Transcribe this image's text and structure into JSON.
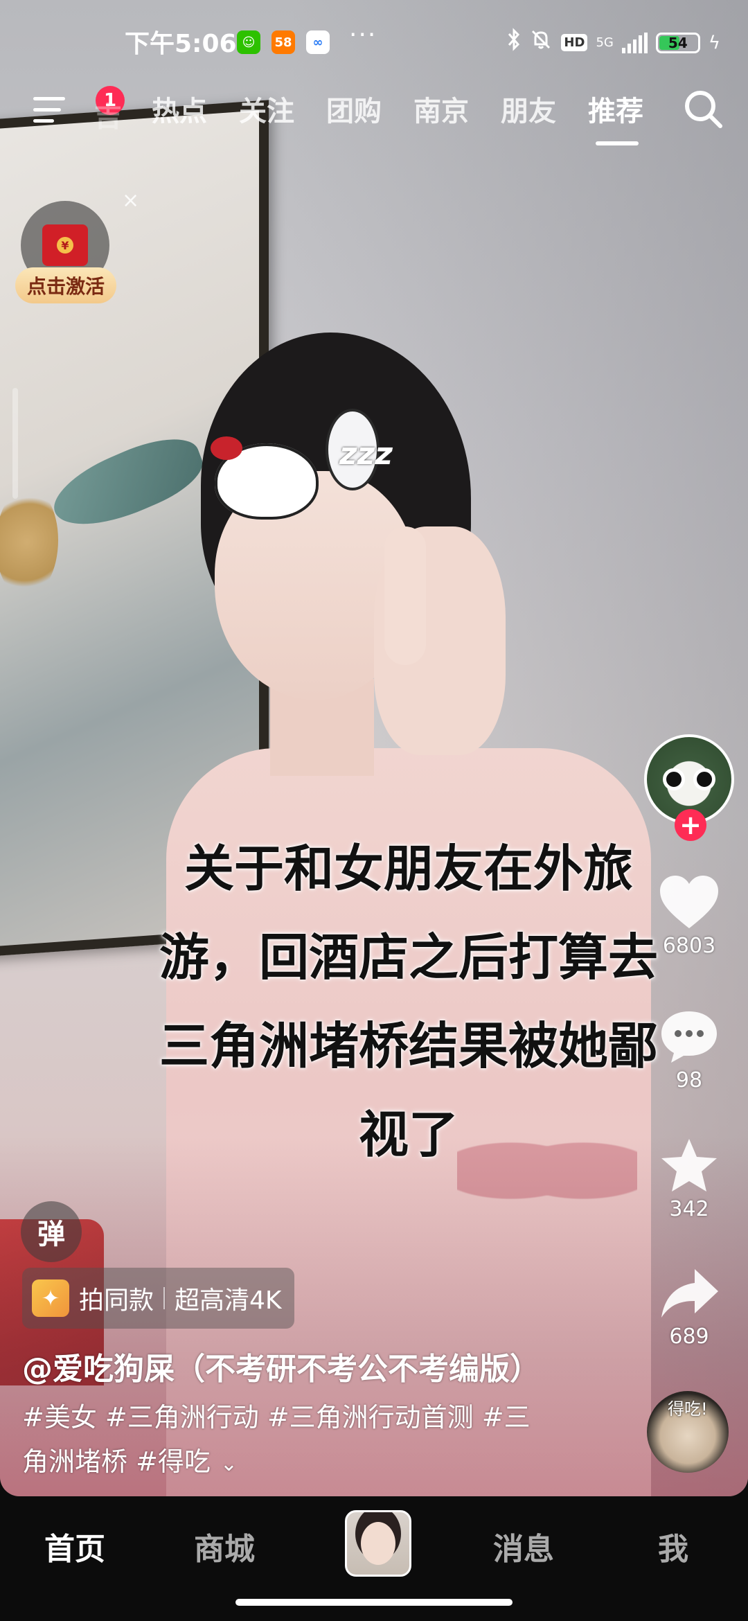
{
  "status_bar": {
    "time": "下午5:06",
    "app_icons": [
      "wechat-icon",
      "58-app-icon",
      "cloud-app-icon"
    ],
    "more": "···",
    "network": "5G",
    "hd": "HD",
    "battery": "54",
    "battery_level": 0.54
  },
  "top_nav": {
    "notification_count": "1",
    "faded_tab": "吉",
    "tabs": [
      "热点",
      "关注",
      "团购",
      "南京",
      "朋友",
      "推荐"
    ],
    "active_tab": "推荐"
  },
  "envelope_widget": {
    "label": "点击激活",
    "close": "×",
    "coin": "¥"
  },
  "video": {
    "caption_lines": [
      "关于和女朋友在外旅",
      "游，回酒店之后打算去",
      "三角洲堵桥结果被她鄙",
      "视了"
    ],
    "sticker_text": "zzz"
  },
  "actions": {
    "follow": "+",
    "likes": "6803",
    "comments": "98",
    "favorites": "342",
    "shares": "689"
  },
  "info": {
    "danmaku_label": "弹",
    "promo_shoot_same": "拍同款",
    "promo_quality": "超高清4K",
    "author": "@爱吃狗屎（不考研不考公不考编版）",
    "hashtags_line1": "#美女 #三角洲行动 #三角洲行动首测 #三",
    "hashtags_line2": "角洲堵桥 #得吃",
    "music_tag": "得吃!"
  },
  "bottom_nav": {
    "home": "首页",
    "mall": "商城",
    "messages": "消息",
    "me": "我"
  },
  "colors": {
    "accent_red": "#fe2c55",
    "battery_green": "#35c759"
  }
}
